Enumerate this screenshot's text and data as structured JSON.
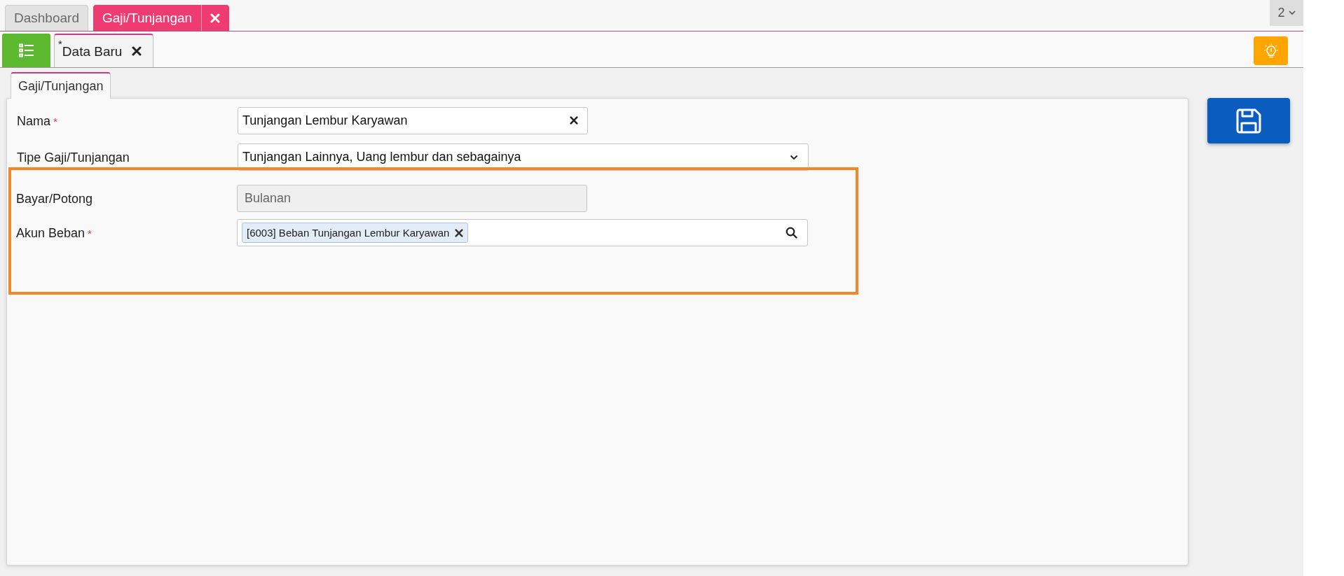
{
  "top_tabs": [
    {
      "label": "Dashboard",
      "selected": false,
      "closable": false
    },
    {
      "label": "Gaji/Tunjangan",
      "selected": true,
      "closable": true
    }
  ],
  "tab_count": "2",
  "doc_tabs": [
    {
      "modified_mark": "*",
      "label": "Data Baru",
      "selected": true
    }
  ],
  "section_tabs": [
    {
      "label": "Gaji/Tunjangan",
      "selected": true
    }
  ],
  "fields": [
    {
      "label": "Nama",
      "required_mark": "*",
      "kind": "text",
      "value": "Tunjangan Lembur Karyawan",
      "clearable": true,
      "disabled": false,
      "highlighted": false
    },
    {
      "label": "Tipe Gaji/Tunjangan",
      "kind": "select",
      "value": "Tunjangan Lainnya, Uang lembur dan sebagainya",
      "disabled": false,
      "highlighted": false
    },
    {
      "label": "Bayar/Potong",
      "kind": "text",
      "value": "Bulanan",
      "clearable": false,
      "disabled": true,
      "highlighted": true
    },
    {
      "label": "Akun Beban",
      "required_mark": "*",
      "kind": "lookup",
      "tags": [
        "[6003] Beban Tunjangan Lembur Karyawan"
      ],
      "disabled": false,
      "highlighted": true
    }
  ]
}
